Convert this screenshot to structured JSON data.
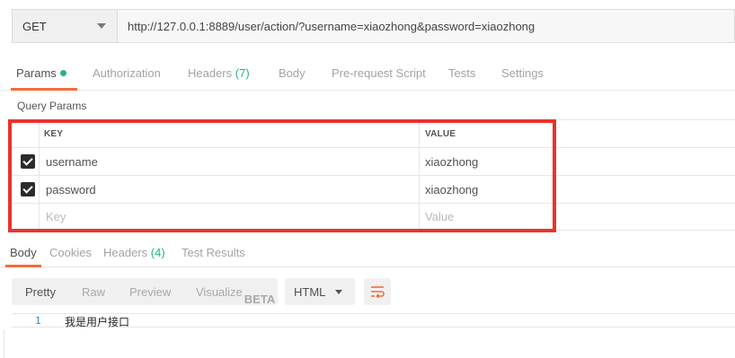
{
  "request": {
    "method": "GET",
    "url": "http://127.0.0.1:8889/user/action/?username=xiaozhong&password=xiaozhong"
  },
  "request_tabs": [
    {
      "label": "Params",
      "active": true,
      "dot": true
    },
    {
      "label": "Authorization"
    },
    {
      "label": "Headers",
      "count": "(7)"
    },
    {
      "label": "Body"
    },
    {
      "label": "Pre-request Script"
    },
    {
      "label": "Tests"
    },
    {
      "label": "Settings"
    }
  ],
  "query_params": {
    "title": "Query Params",
    "headers": {
      "key": "KEY",
      "value": "VALUE"
    },
    "rows": [
      {
        "checked": true,
        "key": "username",
        "value": "xiaozhong"
      },
      {
        "checked": true,
        "key": "password",
        "value": "xiaozhong"
      }
    ],
    "placeholder": {
      "key": "Key",
      "value": "Value"
    }
  },
  "response_tabs": [
    {
      "label": "Body",
      "active": true
    },
    {
      "label": "Cookies"
    },
    {
      "label": "Headers",
      "count": "(4)"
    },
    {
      "label": "Test Results"
    }
  ],
  "body_toolbar": {
    "modes": [
      "Pretty",
      "Raw",
      "Preview",
      "Visualize"
    ],
    "active_mode": "Pretty",
    "beta": "BETA",
    "format": "HTML"
  },
  "response_body": {
    "line_number": "1",
    "text": "我是用户接口"
  },
  "colors": {
    "accent": "#f26b3a",
    "count_green": "#26b47f",
    "highlight_red": "#e8332d"
  },
  "icons": [
    "chevron-down-icon",
    "checkbox-checked-icon",
    "wrap-lines-icon"
  ]
}
